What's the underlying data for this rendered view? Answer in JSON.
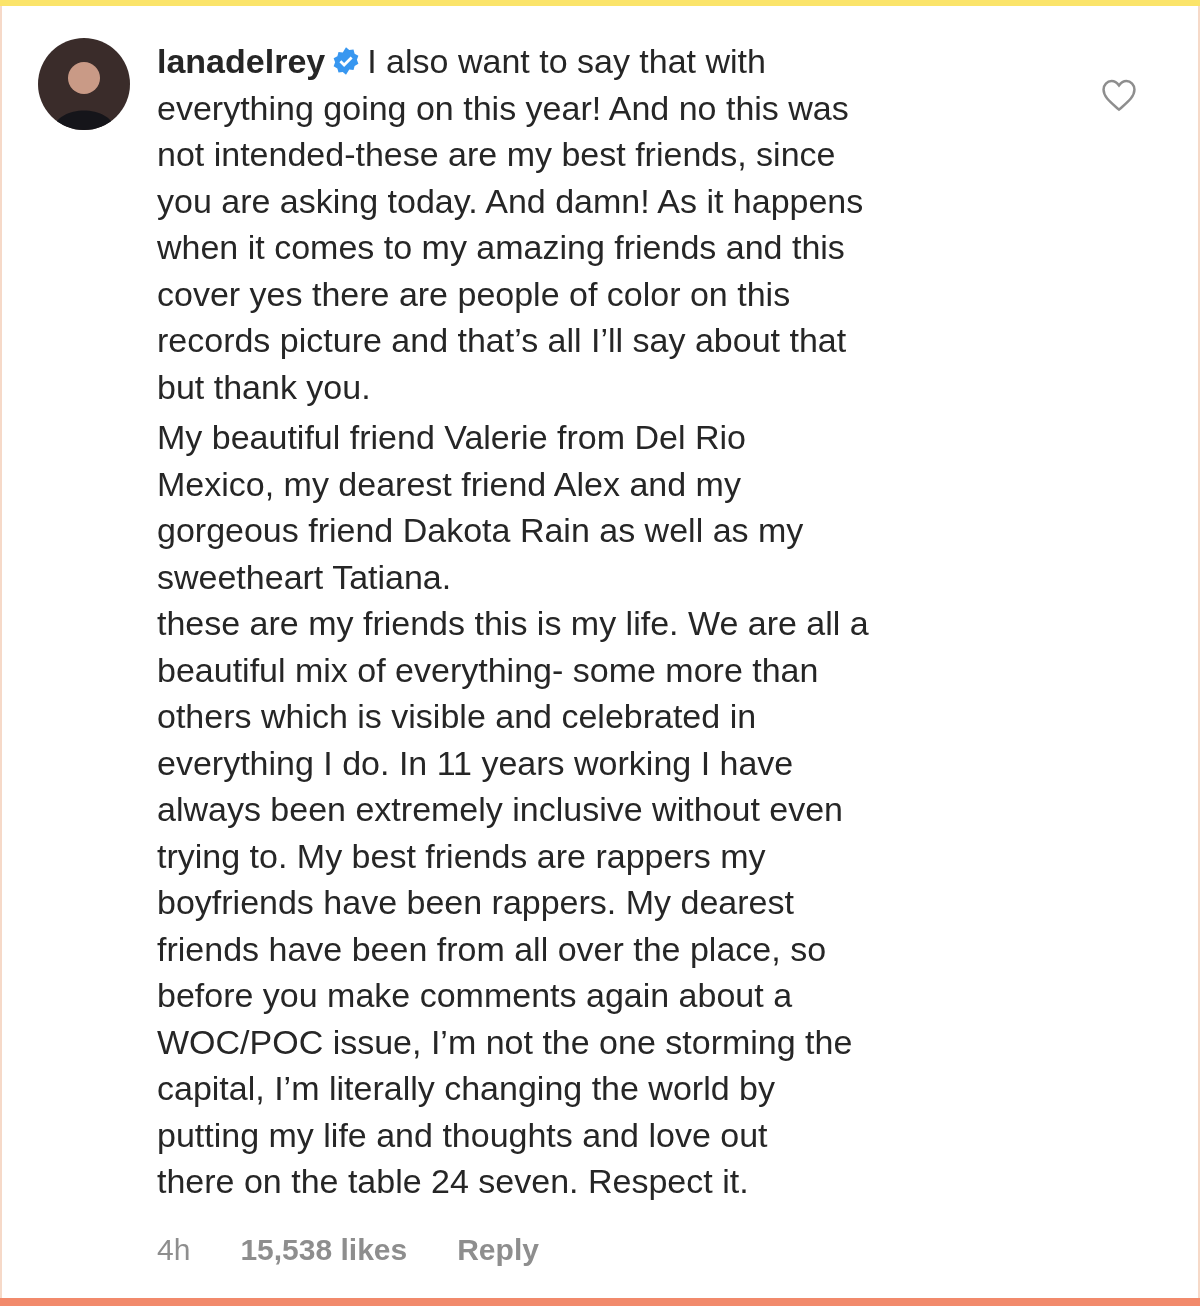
{
  "comment": {
    "username": "lanadelrey",
    "verified": true,
    "liked": false,
    "paragraphs": [
      "I also want to say that with\neverything going on this year! And no this was\nnot intended-these are my best friends, since\nyou are asking today. And damn! As it happens\nwhen it comes to my amazing friends and this\ncover yes there are people of color on this\nrecords picture and that’s all I’ll say about that\nbut thank you.",
      "My beautiful friend Valerie from Del Rio\nMexico, my dearest friend Alex and my\ngorgeous friend Dakota Rain as well as my\nsweetheart Tatiana.",
      "these are my friends this is my life. We are all a\nbeautiful mix of everything- some more than\nothers which is visible and celebrated in\neverything I do. In 11 years working I have\nalways been extremely inclusive without even\ntrying to. My best friends are rappers my\nboyfriends have been rappers. My dearest\nfriends have been from all over the place, so\nbefore you make comments again  about a\nWOC/POC issue, I’m not the one storming the\ncapital, I’m literally changing the world by\nputting my life and thoughts and love  out\nthere on the table 24 seven. Respect it."
    ],
    "time": "4h",
    "likes": "15,538 likes",
    "reply": "Reply"
  }
}
